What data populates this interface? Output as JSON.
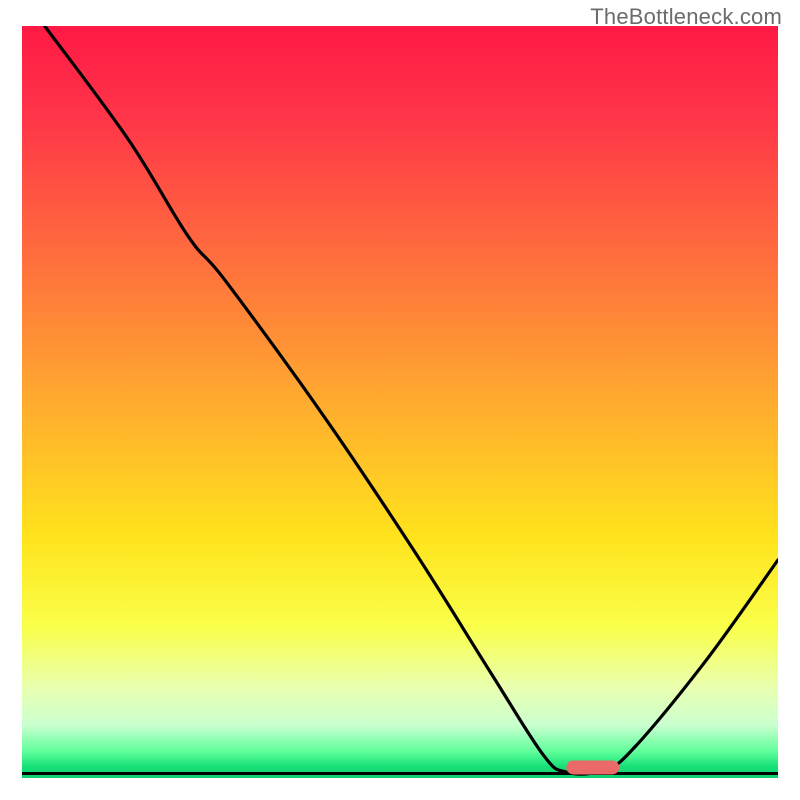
{
  "watermark": "TheBottleneck.com",
  "chart_data": {
    "type": "line",
    "title": "",
    "xlabel": "",
    "ylabel": "",
    "xlim": [
      0,
      100
    ],
    "ylim": [
      0,
      100
    ],
    "gradient_stops": [
      {
        "offset": 0.0,
        "color": "#ff1945"
      },
      {
        "offset": 0.12,
        "color": "#ff3549"
      },
      {
        "offset": 0.3,
        "color": "#ff6b3e"
      },
      {
        "offset": 0.5,
        "color": "#ffab2f"
      },
      {
        "offset": 0.68,
        "color": "#ffe31c"
      },
      {
        "offset": 0.8,
        "color": "#f9ff4a"
      },
      {
        "offset": 0.88,
        "color": "#e9ffb0"
      },
      {
        "offset": 0.93,
        "color": "#c9ffcf"
      },
      {
        "offset": 0.965,
        "color": "#5fff9a"
      },
      {
        "offset": 0.985,
        "color": "#17e077"
      },
      {
        "offset": 1.0,
        "color": "#0fd071"
      }
    ],
    "curve": [
      {
        "x": 3,
        "y": 100
      },
      {
        "x": 14,
        "y": 85
      },
      {
        "x": 22,
        "y": 72
      },
      {
        "x": 27,
        "y": 66
      },
      {
        "x": 40,
        "y": 48
      },
      {
        "x": 52,
        "y": 30
      },
      {
        "x": 62,
        "y": 14
      },
      {
        "x": 69,
        "y": 3
      },
      {
        "x": 72,
        "y": 0.8
      },
      {
        "x": 76,
        "y": 0.8
      },
      {
        "x": 80,
        "y": 3
      },
      {
        "x": 90,
        "y": 15
      },
      {
        "x": 100,
        "y": 29
      }
    ],
    "marker": {
      "x_start": 72,
      "x_end": 79,
      "y": 1.4,
      "color": "#ea6a6a",
      "thickness": 14
    },
    "baseline_y": 0.6
  }
}
